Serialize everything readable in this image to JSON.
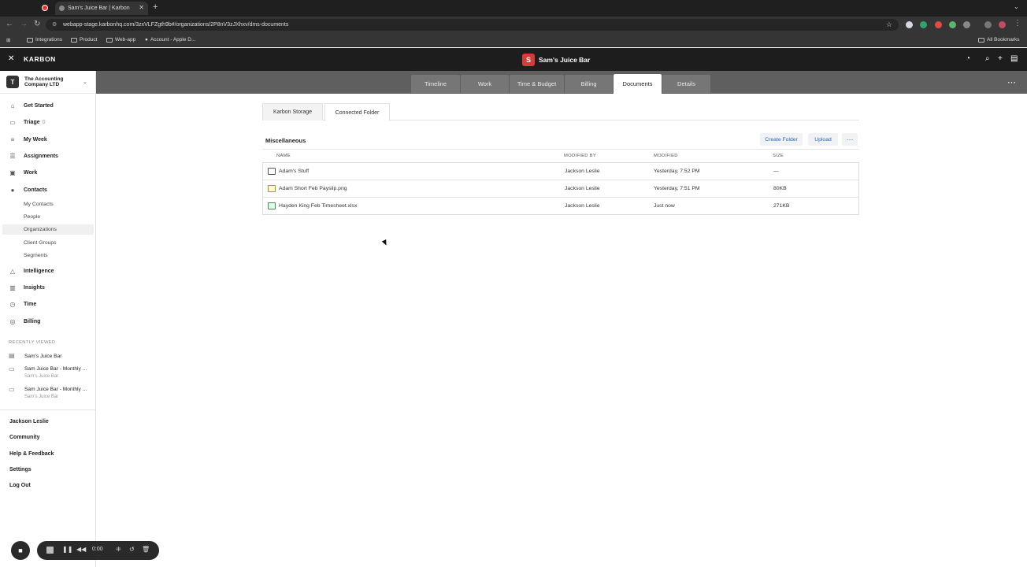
{
  "browser": {
    "tab_title": "Sam's Juice Bar | Karbon",
    "url": "webapp-stage.karbonhq.com/3zxVLFZgth9b#/organizations/2P8nV3zJXhxv/dms-documents",
    "bookmarks": [
      "Integrations",
      "Product",
      "Web-app",
      "Account - Apple D..."
    ],
    "all_bookmarks": "All Bookmarks"
  },
  "app": {
    "brand": "KARBON",
    "org_initial": "S",
    "org_name": "Sam's Juice Bar"
  },
  "sidebar": {
    "company_initial": "T",
    "company_name": "The Accounting Company LTD",
    "nav": [
      {
        "label": "Get Started",
        "icon": "home-icon"
      },
      {
        "label": "Triage",
        "badge": "0",
        "icon": "inbox-icon"
      },
      {
        "label": "My Week",
        "icon": "list-icon"
      },
      {
        "label": "Assignments",
        "icon": "checklist-icon"
      },
      {
        "label": "Work",
        "icon": "briefcase-icon"
      },
      {
        "label": "Contacts",
        "icon": "person-icon"
      }
    ],
    "contacts_sub": [
      "My Contacts",
      "People",
      "Organizations",
      "Client Groups",
      "Segments"
    ],
    "nav2": [
      {
        "label": "Intelligence",
        "icon": "flask-icon"
      },
      {
        "label": "Insights",
        "icon": "bar-chart-icon"
      },
      {
        "label": "Time",
        "icon": "clock-icon"
      },
      {
        "label": "Billing",
        "icon": "billing-icon"
      }
    ],
    "recently_viewed_heading": "RECENTLY VIEWED",
    "recent": [
      {
        "title": "Sam's Juice Bar",
        "subtitle": ""
      },
      {
        "title": "Sam Juice Bar - Monthly ...",
        "subtitle": "Sam's Juice Bar"
      },
      {
        "title": "Sam Juice Bar - Monthly ...",
        "subtitle": "Sam's Juice Bar"
      }
    ],
    "footer": [
      "Jackson Leslie",
      "Community",
      "Help & Feedback",
      "Settings",
      "Log Out"
    ]
  },
  "recorder": {
    "time": "0:00"
  },
  "main": {
    "tabs": [
      "Timeline",
      "Work",
      "Time & Budget",
      "Billing",
      "Documents",
      "Details"
    ],
    "active_tab": "Documents",
    "subtabs": [
      "Karbon Storage",
      "Connected Folder"
    ],
    "active_subtab": "Connected Folder",
    "section_title": "Miscellaneous",
    "create_folder": "Create Folder",
    "upload": "Upload",
    "more": "···",
    "columns": [
      "NAME",
      "MODIFIED BY",
      "MODIFIED",
      "SIZE"
    ],
    "rows": [
      {
        "type": "folder",
        "name": "Adam's Stuff",
        "modified_by": "Jackson Leslie",
        "modified": "Yesterday, 7:52 PM",
        "size": "—"
      },
      {
        "type": "image",
        "name": "Adam Short Feb Payslip.png",
        "modified_by": "Jackson Leslie",
        "modified": "Yesterday, 7:51 PM",
        "size": "80KB"
      },
      {
        "type": "sheet",
        "name": "Hayden King Feb Timesheet.xlsx",
        "modified_by": "Jackson Leslie",
        "modified": "Just now",
        "size": "271KB"
      }
    ]
  }
}
